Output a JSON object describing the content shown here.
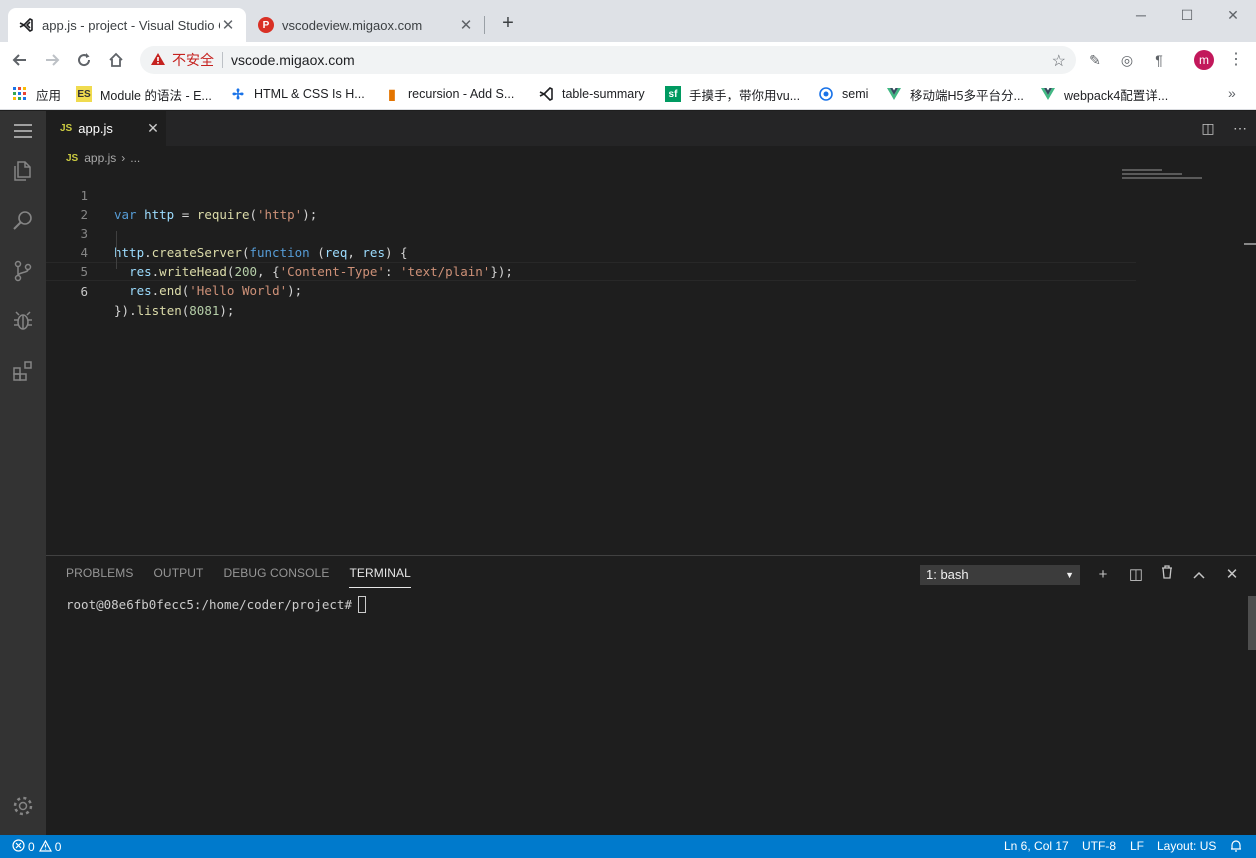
{
  "browser": {
    "tabs": [
      {
        "title": "app.js - project - Visual Studio Code",
        "active": true
      },
      {
        "title": "vscodeview.migaox.com",
        "active": false
      }
    ],
    "omnibox": {
      "security_label": "不安全",
      "url": "vscode.migaox.com"
    },
    "bookmarks": [
      {
        "label": "应用",
        "icon": "apps-grid-icon"
      },
      {
        "label": "Module 的语法 - E...",
        "icon": "es-icon"
      },
      {
        "label": "HTML & CSS Is H...",
        "icon": "html-css-icon"
      },
      {
        "label": "recursion - Add S...",
        "icon": "recursion-icon"
      },
      {
        "label": "table-summary",
        "icon": "vscode-icon"
      },
      {
        "label": "手摸手，带你用vu...",
        "icon": "sf-icon"
      },
      {
        "label": "semi",
        "icon": "semi-icon"
      },
      {
        "label": "移动端H5多平台分...",
        "icon": "vue-icon"
      },
      {
        "label": "webpack4配置详...",
        "icon": "vue-icon"
      }
    ],
    "avatar_letter": "m",
    "colors": {
      "titlebar": "#dee1e6",
      "warning": "#c5221f",
      "avatar": "#c2185b"
    }
  },
  "editor": {
    "tab": {
      "icon_text": "JS",
      "name": "app.js"
    },
    "breadcrumb": {
      "icon_text": "JS",
      "file": "app.js",
      "rest": "..."
    },
    "line_numbers": [
      "1",
      "2",
      "3",
      "4",
      "5",
      "6"
    ],
    "code_tokens": {
      "l1": [
        "var",
        "http",
        "=",
        "require",
        "(",
        "'http'",
        ");"
      ],
      "l3": [
        "http",
        ".",
        "createServer",
        "(",
        "function",
        " (",
        "req",
        ", ",
        "res",
        ") {"
      ],
      "l4": [
        "res",
        ".",
        "writeHead",
        "(",
        "200",
        ", {",
        "'Content-Type'",
        ": ",
        "'text/plain'",
        "});"
      ],
      "l5": [
        "res",
        ".",
        "end",
        "(",
        "'Hello World'",
        ");"
      ],
      "l6": [
        "})",
        ".",
        "listen",
        "(",
        "8081",
        ");"
      ]
    }
  },
  "panel": {
    "tabs": [
      "PROBLEMS",
      "OUTPUT",
      "DEBUG CONSOLE",
      "TERMINAL"
    ],
    "active_tab": "TERMINAL",
    "terminal_select": "1: bash",
    "prompt": "root@08e6fb0fecc5:/home/coder/project#"
  },
  "statusbar": {
    "errors": "0",
    "warnings": "0",
    "position": "Ln 6, Col 17",
    "encoding": "UTF-8",
    "eol": "LF",
    "layout": "Layout: US"
  },
  "colors": {
    "statusbar": "#007acc",
    "activitybar": "#333333",
    "editor_bg": "#1e1e1e"
  }
}
